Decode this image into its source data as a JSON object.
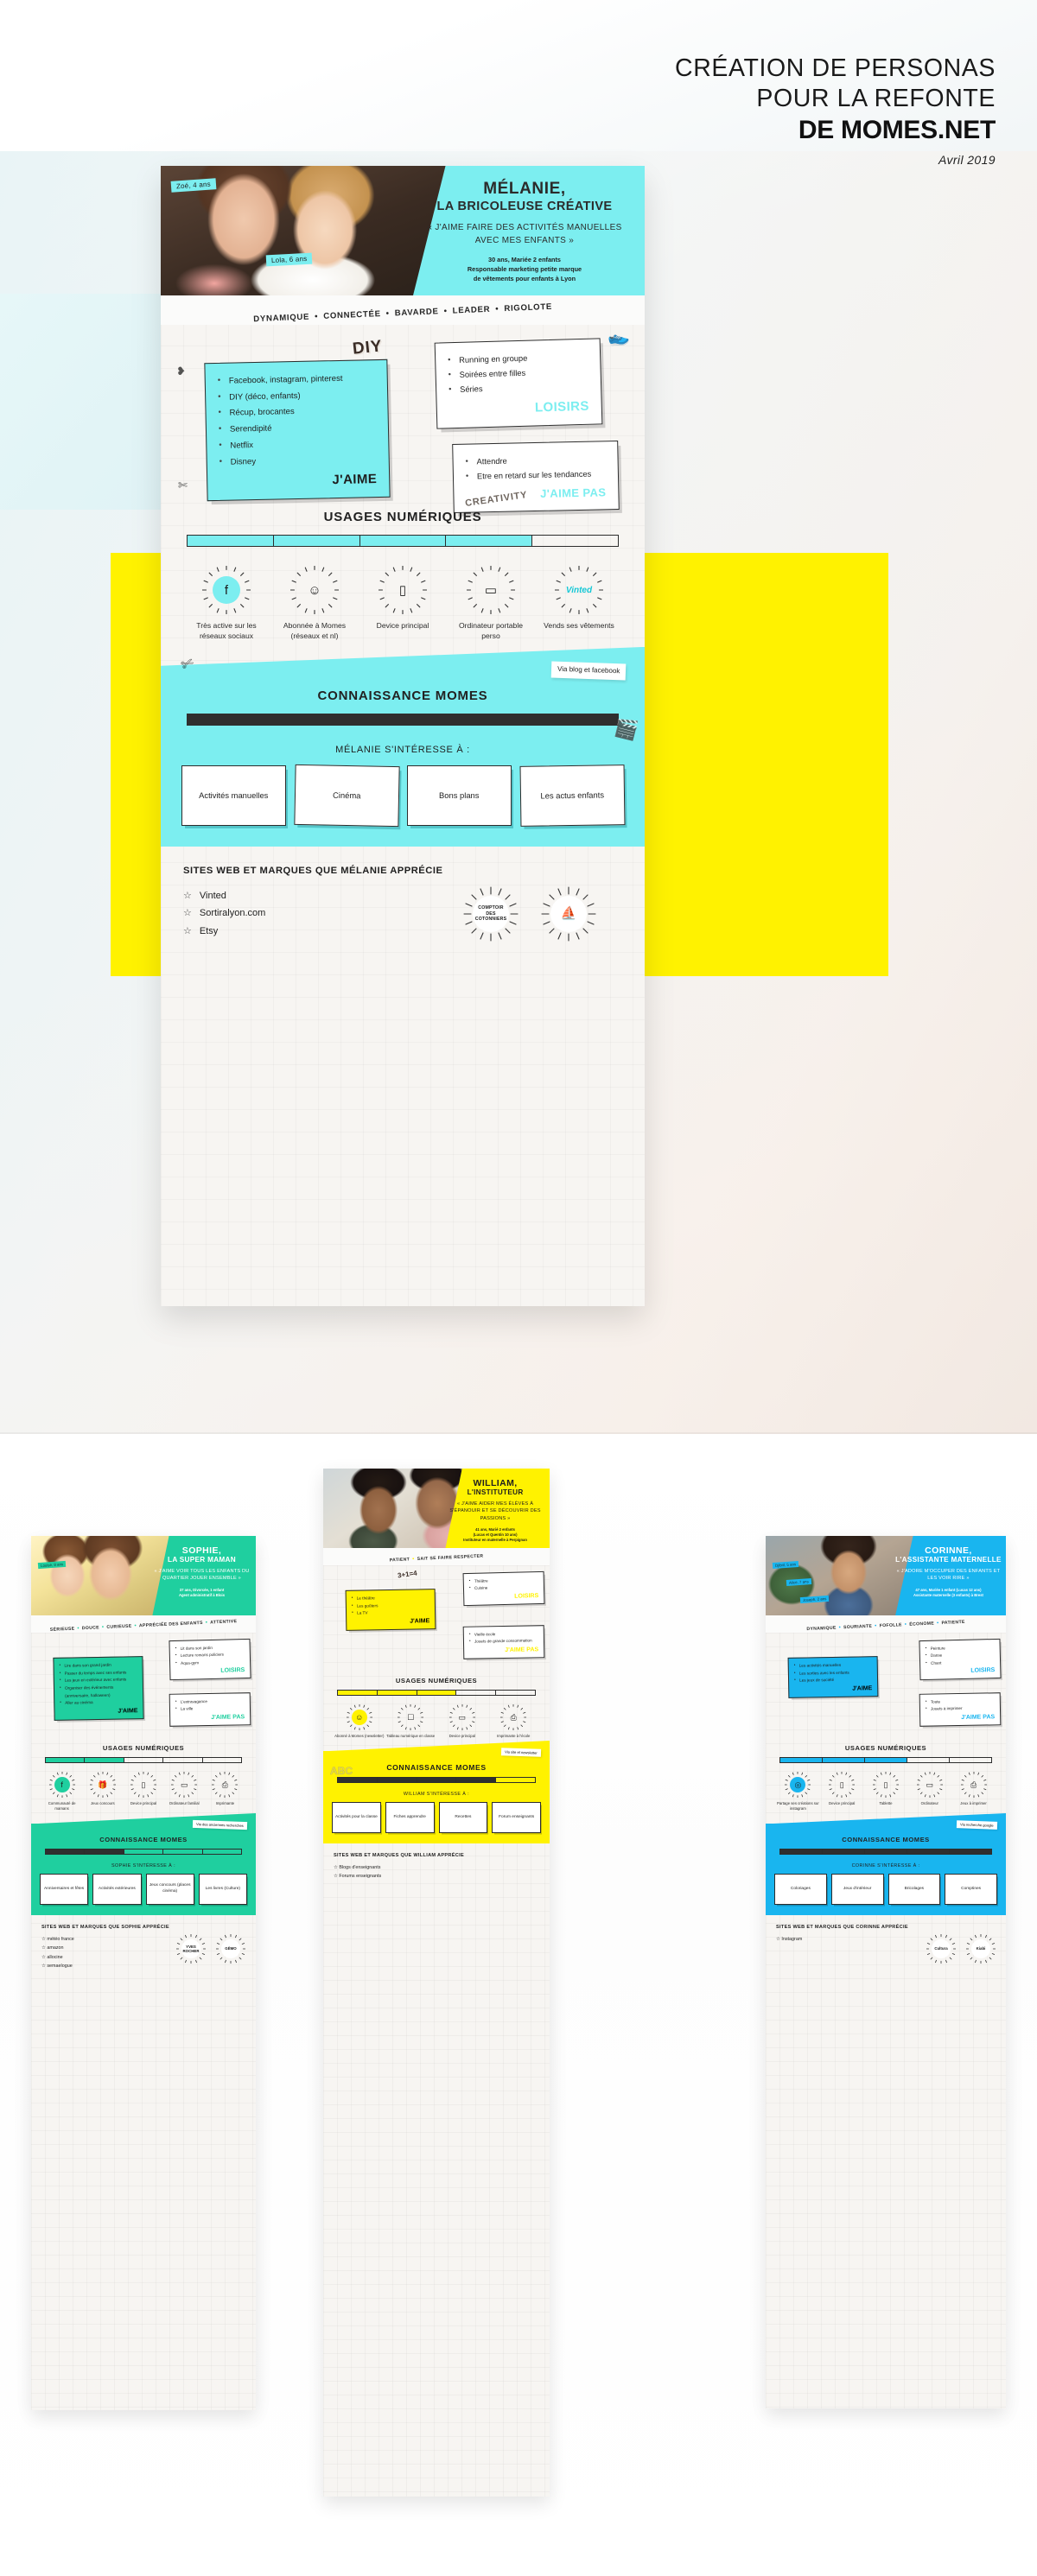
{
  "header": {
    "line1": "CRÉATION DE PERSONAS",
    "line2": "POUR LA REFONTE",
    "line3": "DE MOMES.NET",
    "date": "Avril 2019"
  },
  "colors": {
    "cyan": "#7ceef0",
    "yellow": "#fff200",
    "green": "#1fcf9f",
    "blue": "#19b5ef",
    "dark": "#2f2f2f"
  },
  "main_persona": {
    "name": "MÉLANIE,",
    "subtitle": "LA BRICOLEUSE CRÉATIVE",
    "quote": "« J'AIME FAIRE DES ACTIVITÉS MANUELLES AVEC MES ENFANTS »",
    "meta_line1": "30 ans, Mariée 2 enfants",
    "meta_line2": "Responsable marketing petite marque",
    "meta_line3": "de vêtements pour enfants à Lyon",
    "kid_tags": [
      "Zoé, 4 ans",
      "Lola, 6 ans"
    ],
    "traits": [
      "DYNAMIQUE",
      "CONNECTÉE",
      "BAVARDE",
      "LEADER",
      "RIGOLOTE"
    ],
    "doodle_diy": "DIY",
    "doodle_creativity": "CREATIVITY",
    "likes_label": "J'AIME",
    "likes": [
      "Facebook, instagram, pinterest",
      "DIY (déco, enfants)",
      "Récup, brocantes",
      "Serendipité",
      "Netflix",
      "Disney"
    ],
    "loisirs_label": "LOISIRS",
    "loisirs": [
      "Running en groupe",
      "Soirées entre filles",
      "Séries"
    ],
    "dislikes_label": "J'AIME PAS",
    "dislikes": [
      "Attendre",
      "Etre en retard sur les tendances"
    ],
    "usages_title": "USAGES NUMÉRIQUES",
    "usages_meter_filled": 4,
    "usages_meter_total": 5,
    "usages": [
      {
        "icon": "social-networks-icon",
        "glyph": "f",
        "label": "Très active sur les réseaux sociaux",
        "highlight": true
      },
      {
        "icon": "subscriber-icon",
        "glyph": "☺",
        "label": "Abonnée à Momes (réseaux et nl)",
        "highlight": false
      },
      {
        "icon": "smartphone-icon",
        "glyph": "▯",
        "label": "Device principal",
        "highlight": false
      },
      {
        "icon": "laptop-icon",
        "glyph": "▭",
        "label": "Ordinateur portable perso",
        "highlight": false
      },
      {
        "icon": "vinted-icon",
        "glyph": "Vinted",
        "label": "Vends ses vêtements",
        "highlight": false
      }
    ],
    "connaissance_title": "CONNAISSANCE MOMES",
    "connaissance_meter_filled": 5,
    "connaissance_meter_total": 5,
    "connaissance_sub": "MÉLANIE S'INTÉRESSE À :",
    "connaissance_note": "Via blog et facebook",
    "interests": [
      "Activités manuelles",
      "Cinéma",
      "Bons plans",
      "Les actus enfants"
    ],
    "sites_title": "SITES WEB ET MARQUES QUE MÉLANIE APPRÉCIE",
    "sites": [
      "Vinted",
      "Sortiralyon.com",
      "Etsy"
    ],
    "brands": [
      "COMPTOIR DES COTONNIERS",
      "PETIT BATEAU"
    ]
  },
  "mini_personas": [
    {
      "id": "sophie",
      "accent": "#1fcf9f",
      "name": "SOPHIE,",
      "subtitle": "LA SUPER MAMAN",
      "quote": "« J'AIME VOIR TOUS LES ENFANTS DU QUARTIER JOUER ENSEMBLE »",
      "meta_line1": "37 ans, Divorcée, 1 enfant",
      "meta_line2": "Agent administratif à Blois",
      "kid_tags": [
        "Louise, 8 ans"
      ],
      "traits": [
        "SÉRIEUSE",
        "DOUCE",
        "CURIEUSE",
        "APPRÉCIÉE DES ENFANTS",
        "ATTENTIVE"
      ],
      "likes_label": "J'AIME",
      "likes": [
        "Lire dans son grand jardin",
        "Passer du temps avec ses enfants",
        "Les jeux en extérieur avec enfants",
        "Organiser des événements (anniversaire, halloween)",
        "Aller au cinéma"
      ],
      "loisirs_label": "LOISIRS",
      "loisirs": [
        "Lit dans son jardin",
        "Lecture romans policiers",
        "Aqua-gym"
      ],
      "dislikes_label": "J'AIME PAS",
      "dislikes": [
        "L'extravagance",
        "La ville"
      ],
      "usages_title": "USAGES NUMÉRIQUES",
      "usages_meter_filled": 2,
      "usages_meter_total": 5,
      "usages": [
        {
          "icon": "facebook-icon",
          "glyph": "f",
          "label": "Communauté de mamans",
          "highlight": true
        },
        {
          "icon": "gift-icon",
          "glyph": "🎁",
          "label": "Jeux concours",
          "highlight": false
        },
        {
          "icon": "smartphone-icon",
          "glyph": "▯",
          "label": "Device principal",
          "highlight": false
        },
        {
          "icon": "desktop-icon",
          "glyph": "▭",
          "label": "Ordinateur familial",
          "highlight": false
        },
        {
          "icon": "printer-icon",
          "glyph": "⎙",
          "label": "Imprimante",
          "highlight": false
        }
      ],
      "connaissance_title": "CONNAISSANCE MOMES",
      "connaissance_meter_filled": 2,
      "connaissance_meter_total": 5,
      "connaissance_sub": "SOPHIE S'INTÉRESSE À :",
      "connaissance_note": "Via des anciennes recherches",
      "interests": [
        "Anniversaires et fêtes",
        "Activités extérieures",
        "Jeux concours (places cinéma)",
        "Les livres (Culture)"
      ],
      "sites_title": "SITES WEB ET MARQUES QUE SOPHIE APPRÉCIE",
      "sites": [
        "météo france",
        "amazon",
        "allocine",
        "semaelogue"
      ],
      "brands": [
        "YVES ROCHER",
        "GĒMO"
      ]
    },
    {
      "id": "william",
      "accent": "#fff200",
      "name": "WILLIAM,",
      "subtitle": "L'INSTITUTEUR",
      "quote": "« J'AIME AIDER MES ÉLÈVES À S'ÉPANOUIR ET SE DÉCOUVRIR DES PASSIONS »",
      "meta_line1": "41 ans, Marié 2 enfants",
      "meta_line2": "(Lucas et Quentin 10 ans)",
      "meta_line3": "Instituteur en maternelle à Perpignan",
      "kid_tags": [],
      "traits": [
        "PATIENT",
        "SAIT SE FAIRE RESPECTER"
      ],
      "doodle_math": "3+1=4",
      "likes_label": "J'AIME",
      "likes": [
        "Le théâtre",
        "Les goûters",
        "La TV"
      ],
      "loisirs_label": "LOISIRS",
      "loisirs": [
        "Théâtre",
        "Cuisine"
      ],
      "dislikes_label": "J'AIME PAS",
      "dislikes": [
        "Vieille école",
        "Jouets de grande consommation"
      ],
      "usages_title": "USAGES NUMÉRIQUES",
      "usages_meter_filled": 3,
      "usages_meter_total": 5,
      "usages": [
        {
          "icon": "subscriber-icon",
          "glyph": "☺",
          "label": "Abonné à Momes (newsletter)",
          "highlight": true
        },
        {
          "icon": "touchboard-icon",
          "glyph": "☐",
          "label": "Tableau numérique en classe",
          "highlight": false
        },
        {
          "icon": "laptop-icon",
          "glyph": "▭",
          "label": "Device principal",
          "highlight": false
        },
        {
          "icon": "printer-icon",
          "glyph": "⎙",
          "label": "Imprimante à l'école",
          "highlight": false
        }
      ],
      "connaissance_title": "CONNAISSANCE MOMES",
      "connaissance_meter_filled": 4,
      "connaissance_meter_total": 5,
      "connaissance_sub": "WILLIAM S'INTÉRESSE À :",
      "connaissance_note": "Via site et newsletter",
      "doodle_abc": "ABC",
      "interests": [
        "Activités pour la classe",
        "Fiches apprendre",
        "Recettes",
        "Forum enseignants"
      ],
      "sites_title": "SITES WEB ET MARQUES QUE WILLIAM APPRÉCIE",
      "sites": [
        "Blogs d'enseignants",
        "Forums enseignants"
      ],
      "brands": []
    },
    {
      "id": "corinne",
      "accent": "#19b5ef",
      "name": "CORINNE,",
      "subtitle": "L'ASSISTANTE MATERNELLE",
      "quote": "« J'ADORE M'OCCUPER DES ENFANTS ET LES VOIR RIRE »",
      "meta_line1": "47 ans, Mariée 1 enfant (Lucas 12 ans)",
      "meta_line2": "Assistante maternelle (3 enfants) à Brest",
      "kid_tags": [
        "Djibril, 5 ans",
        "Alice, 7 ans",
        "Joseph, 2 ans"
      ],
      "traits": [
        "DYNAMIQUE",
        "SOURIANTE",
        "FOFOLLE",
        "ÉCONOME",
        "PATIENTE"
      ],
      "likes_label": "J'AIME",
      "likes": [
        "Les activités manuelles",
        "Les sorties avec les enfants",
        "Les jeux de société"
      ],
      "loisirs_label": "LOISIRS",
      "loisirs": [
        "Peinture",
        "Danse",
        "Chant"
      ],
      "dislikes_label": "J'AIME PAS",
      "dislikes": [
        "Toute",
        "Jouets à imprimer"
      ],
      "usages_title": "USAGES NUMÉRIQUES",
      "usages_meter_filled": 3,
      "usages_meter_total": 5,
      "usages": [
        {
          "icon": "instagram-icon",
          "glyph": "◎",
          "label": "Partage ses créations sur instagram",
          "highlight": true
        },
        {
          "icon": "smartphone-icon",
          "glyph": "▯",
          "label": "Device principal",
          "highlight": false
        },
        {
          "icon": "tablet-icon",
          "glyph": "▯",
          "label": "Tablette",
          "highlight": false
        },
        {
          "icon": "desktop-icon",
          "glyph": "▭",
          "label": "Ordinateur",
          "highlight": false
        },
        {
          "icon": "print-icon",
          "glyph": "⎙",
          "label": "Jeux à imprimer",
          "highlight": false
        }
      ],
      "connaissance_title": "CONNAISSANCE MOMES",
      "connaissance_meter_filled": 5,
      "connaissance_meter_total": 5,
      "connaissance_sub": "CORINNE S'INTÉRESSE À :",
      "connaissance_note": "Via recherche google",
      "interests": [
        "Coloriages",
        "Jeux d'intérieur",
        "Bricolages",
        "Comptines"
      ],
      "sites_title": "SITES WEB ET MARQUES QUE CORINNE APPRÉCIE",
      "sites": [
        "Instagram"
      ],
      "brands": [
        "Cultura",
        "Kiabi"
      ]
    }
  ]
}
